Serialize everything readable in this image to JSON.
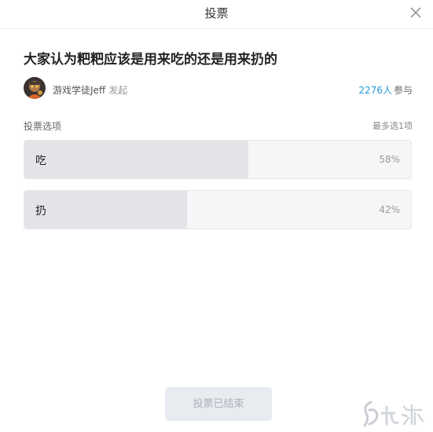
{
  "header": {
    "title": "投票"
  },
  "poll": {
    "question": "大家认为粑粑应该是用来吃的还是用来扔的",
    "author": {
      "name": "游戏学徒Jeff",
      "action": "发起"
    },
    "participants": {
      "count": "2276",
      "unit": "人",
      "suffix": "参与"
    },
    "options_label": "投票选项",
    "options_hint": "最多选1项",
    "options": [
      {
        "label": "吃",
        "percent_text": "58%",
        "percent": 58
      },
      {
        "label": "扔",
        "percent_text": "42%",
        "percent": 42
      }
    ],
    "end_button": "投票已结束"
  },
  "colors": {
    "accent": "#1e9bd7",
    "bar_fill": "#e3e4e7",
    "bar_bg": "#f5f6f7"
  },
  "watermark": {
    "brand_icon": "jiuyou-logo"
  }
}
